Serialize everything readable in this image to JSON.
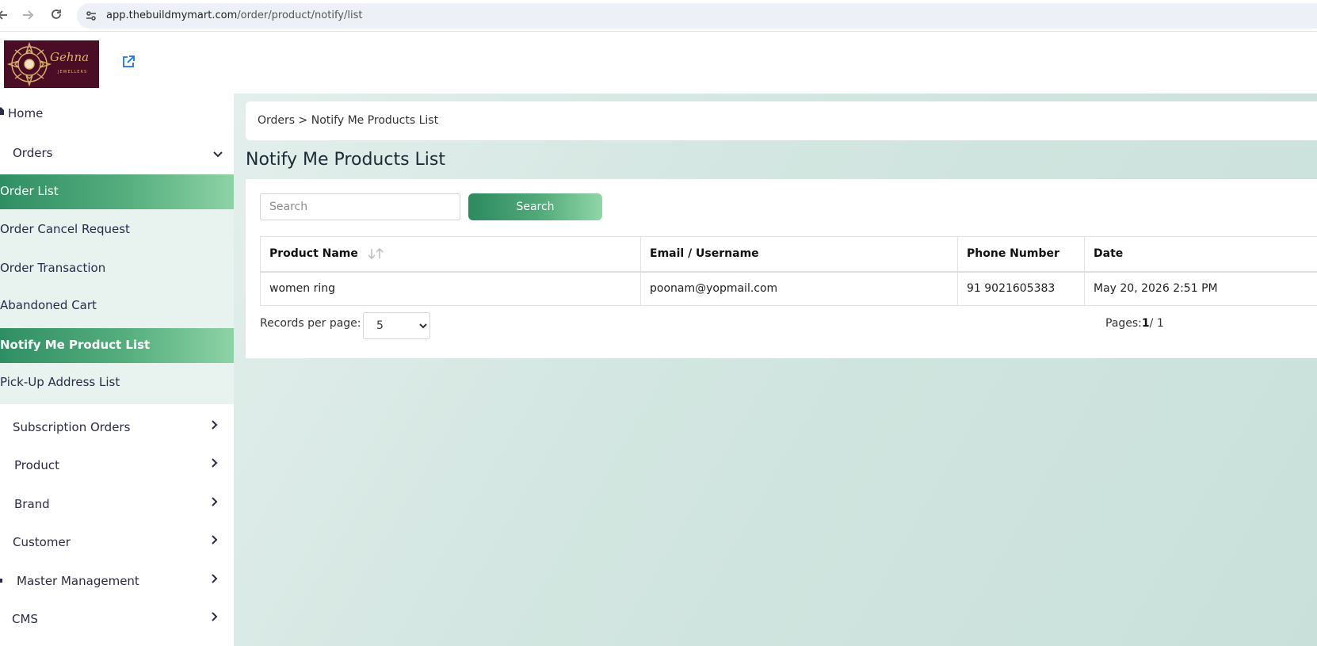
{
  "browser": {
    "url_host": "app.thebuildmymart.com",
    "url_path": "/order/product/notify/list"
  },
  "logo": {
    "text": "Gehna",
    "subtext": "JEWELLERS"
  },
  "sidebar": {
    "home": "Home",
    "orders": "Orders",
    "order_items": [
      "Order List",
      "Order Cancel Request",
      "Order Transaction",
      "Abandoned Cart",
      "Notify Me Product List",
      "Pick-Up Address List"
    ],
    "sections": [
      "Subscription Orders",
      "Product",
      "Brand",
      "Customer",
      "Master Management",
      "CMS"
    ]
  },
  "breadcrumb": {
    "parent": "Orders",
    "separator": ">",
    "current": "Notify Me Products List"
  },
  "page_title": "Notify Me Products List",
  "search": {
    "placeholder": "Search",
    "button_label": "Search"
  },
  "table": {
    "columns": [
      "Product Name",
      "Email / Username",
      "Phone Number",
      "Date"
    ],
    "rows": [
      [
        "women ring",
        "poonam@yopmail.com",
        "91 9021605383",
        "May 20, 2026 2:51 PM"
      ]
    ]
  },
  "pagination": {
    "records_label": "Records per page:",
    "records_value": "5",
    "pages_label": "Pages:",
    "current_page": "1",
    "total_pages": "/ 1"
  },
  "colors": {
    "accent": "#2f8f64",
    "accent_light": "#8dd3a6",
    "main_bg": "#d3e6e1",
    "logo_bg": "#4a0d25"
  }
}
